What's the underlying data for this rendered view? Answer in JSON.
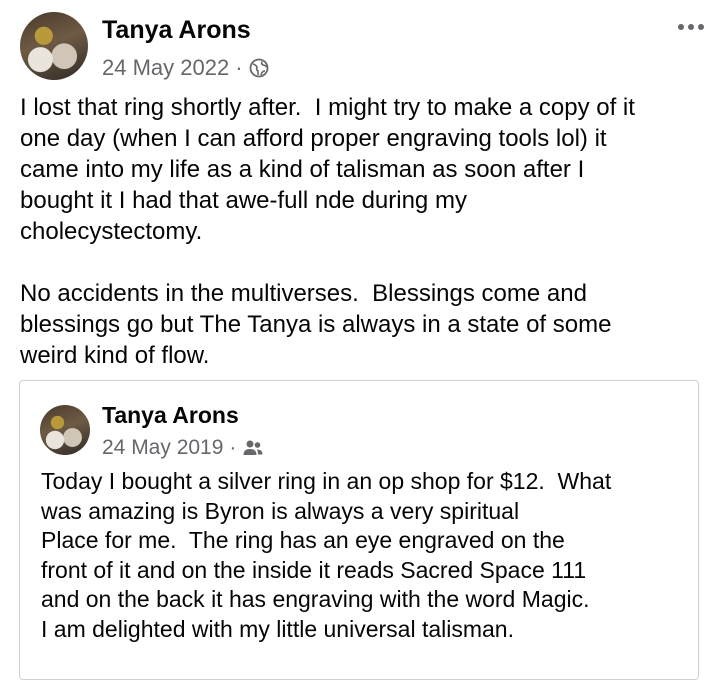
{
  "post": {
    "author": "Tanya Arons",
    "date": "24 May 2022",
    "separator": "·",
    "audience_icon": "globe-icon",
    "more_icon": "more-options-icon",
    "text": "I lost that ring shortly after.  I might try to make a copy of it\none day (when I can afford proper engraving tools lol) it\ncame into my life as a kind of talisman as soon after I\nbought it I had that awe-full nde during my\ncholecystectomy.\n\nNo accidents in the multiverses.  Blessings come and\nblessings go but The Tanya is always in a state of some\nweird kind of flow."
  },
  "shared_post": {
    "author": "Tanya Arons",
    "date": "24 May 2019",
    "separator": "·",
    "audience_icon": "friends-icon",
    "text": "Today I bought a silver ring in an op shop for $12.  What\nwas amazing is Byron is always a very spiritual\nPlace for me.  The ring has an eye engraved on the\nfront of it and on the inside it reads Sacred Space 111\nand on the back it has engraving with the word Magic.\nI am delighted with my little universal talisman."
  },
  "colors": {
    "text": "#050505",
    "meta": "#65676b",
    "card_border": "#ced0d4"
  }
}
